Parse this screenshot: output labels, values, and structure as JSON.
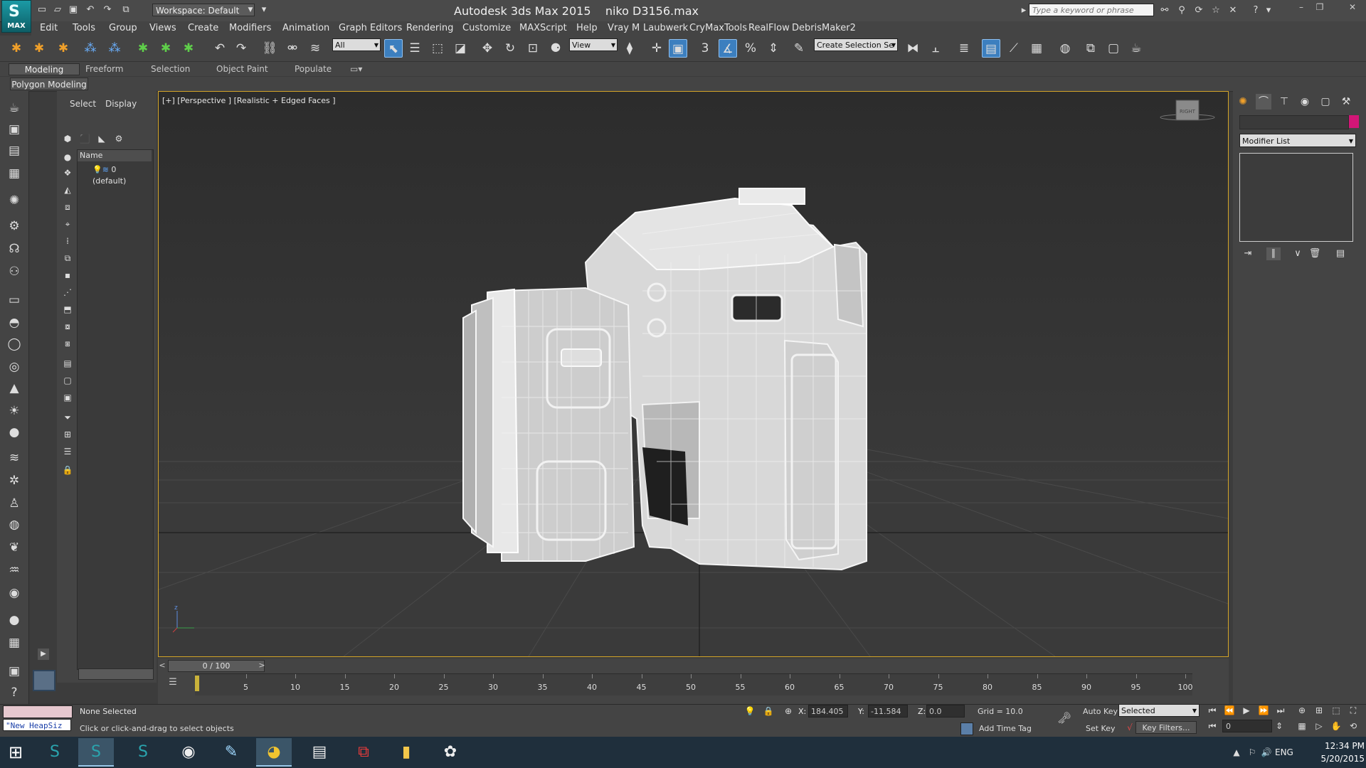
{
  "titlebar": {
    "workspace": "Workspace: Default",
    "app_name": "Autodesk 3ds Max  2015",
    "file_name": "niko D3156.max",
    "search_placeholder": "Type a keyword or phrase",
    "logo_text": "MAX"
  },
  "menu": [
    "Edit",
    "Tools",
    "Group",
    "Views",
    "Create",
    "Modifiers",
    "Animation",
    "Graph Editors",
    "Rendering",
    "Customize",
    "MAXScript",
    "Help",
    "Vray M",
    "Laubwerk",
    "CryMaxTools",
    "RealFlow",
    "DebrisMaker2"
  ],
  "toolbar": {
    "filter_value": "All",
    "refcoord_value": "View",
    "selection_set_placeholder": "Create Selection Se",
    "snap_label": "3"
  },
  "ribbon": {
    "tabs": [
      "Modeling",
      "Freeform",
      "Selection",
      "Object Paint",
      "Populate"
    ],
    "active_panel": "Polygon Modeling"
  },
  "scene_explorer": {
    "tabs": [
      "Select",
      "Display"
    ],
    "column_header": "Name",
    "rows": [
      "0 (default)"
    ]
  },
  "viewport": {
    "label": "[+] [Perspective ] [Realistic + Edged Faces ]",
    "viewcube_label": "RIGHT",
    "gizmo_axis": "z"
  },
  "command_panel": {
    "modifier_list": "Modifier List",
    "object_color": "#d21677"
  },
  "timeline": {
    "slider_text": "0 / 100",
    "prev": "<",
    "next": ">",
    "ticks": [
      "5",
      "10",
      "15",
      "20",
      "25",
      "30",
      "35",
      "40",
      "45",
      "50",
      "55",
      "60",
      "65",
      "70",
      "75",
      "80",
      "85",
      "90",
      "95",
      "100"
    ]
  },
  "status": {
    "selection": "None Selected",
    "prompt": "Click or click-and-drag to select objects",
    "heap": "\"New HeapSiz",
    "x_label": "X:",
    "x_value": "184.405",
    "y_label": "Y:",
    "y_value": "-11.584",
    "z_label": "Z:",
    "z_value": "0.0",
    "grid": "Grid = 10.0",
    "add_time_tag": "Add Time Tag",
    "auto_key": "Auto Key",
    "set_key": "Set Key",
    "selected_dropdown": "Selected",
    "key_filters": "Key Filters...",
    "frame": "0"
  },
  "taskbar": {
    "lang": "ENG",
    "time": "12:34 PM",
    "date": "5/20/2015"
  }
}
